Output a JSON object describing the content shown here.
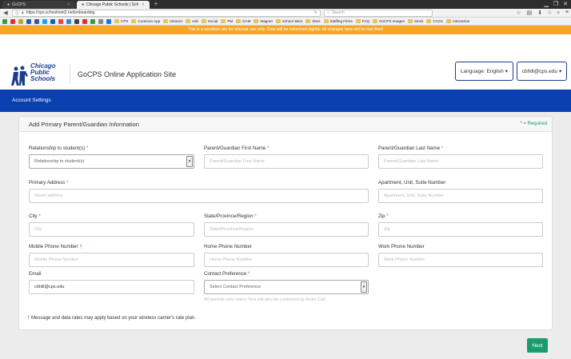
{
  "browser": {
    "tabs": [
      {
        "label": "GoCPS"
      },
      {
        "label": "Chicago Public Schools | Sch"
      }
    ],
    "url": "https://cps.schoolmint2.net/onboarding",
    "search_placeholder": "Search",
    "bookmarks": [
      "CPS",
      "Common App",
      "Intranet",
      "Ads",
      "Social",
      "PM",
      "DAM",
      "Magnet",
      "School Sites",
      "Sites",
      "Staffing Firms",
      "FAQ",
      "GoCPS Images",
      "Stock",
      "CCOL",
      "Interactive"
    ]
  },
  "banner": {
    "text": "This is a sandbox site for internal use only. Data will be refreshed nightly. All changes here will be lost then!"
  },
  "header": {
    "logo_lines": [
      "Chicago",
      "Public",
      "Schools"
    ],
    "site_title": "GoCPS Online Application Site",
    "language_label": "Language: English",
    "user_label": "cbhill@cps.edu"
  },
  "nav": {
    "account_settings": "Account Settings"
  },
  "form": {
    "title": "Add Primary Parent/Guardian Information",
    "required_note": "* = Required",
    "relationship": {
      "label": "Relationship to student(s)",
      "value": "Relationship to student(s)"
    },
    "first_name": {
      "label": "Parent/Guardian First Name",
      "placeholder": "Parent/Guardian First Name"
    },
    "last_name": {
      "label": "Parent/Guardian Last Name",
      "placeholder": "Parent/Guardian Last Name"
    },
    "address": {
      "label": "Primary Address",
      "placeholder": "Street address"
    },
    "apartment": {
      "label": "Apartment, Unit, Suite Number",
      "placeholder": "Apartment, Unit, Suite Number"
    },
    "city": {
      "label": "City",
      "placeholder": "City"
    },
    "state": {
      "label": "State/Province/Region",
      "placeholder": "State/Province/Region"
    },
    "zip": {
      "label": "Zip",
      "placeholder": "Zip"
    },
    "mobile": {
      "label": "Mobile Phone Number",
      "placeholder": "Mobile Phone Number"
    },
    "home_phone": {
      "label": "Home Phone Number",
      "placeholder": "Home Phone Number"
    },
    "work_phone": {
      "label": "Work Phone Number",
      "placeholder": "Work Phone Number"
    },
    "email": {
      "label": "Email",
      "value": "cbhill@cps.edu"
    },
    "contact_pref": {
      "label": "Contact Preference",
      "value": "Select Contact Preference",
      "hint": "All parents who select Text will also be contacted by Robo Call"
    },
    "disclaimer": "Message and data rates may apply based on your wireless carrier's rate plan.",
    "required_mark": "*",
    "dagger_mark": "†"
  },
  "actions": {
    "next_label": "Next"
  },
  "colors": {
    "accent_blue": "#0a3fb0",
    "banner_orange": "#f5a623",
    "success_green": "#1a9c6e"
  }
}
